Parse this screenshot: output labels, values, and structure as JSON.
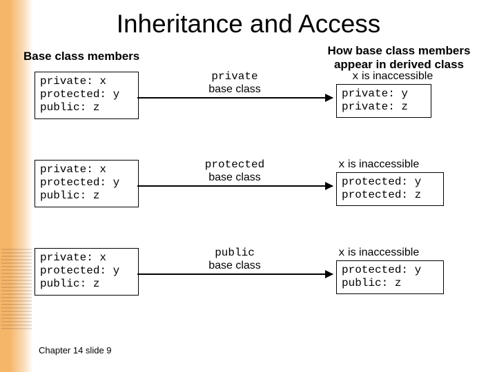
{
  "title": "Inheritance and Access",
  "subtitle_left": "Base class members",
  "subtitle_right": "How base class members appear in derived class",
  "base_members": "private: x\nprotected: y\npublic: z",
  "rows": [
    {
      "arrow_label_kw": "private",
      "arrow_label_rest": "base class",
      "inaccessible_var": "x",
      "inaccessible_text": " is inaccessible",
      "derived_members": "private: y\nprivate: z"
    },
    {
      "arrow_label_kw": "protected",
      "arrow_label_rest": "base class",
      "inaccessible_var": "x",
      "inaccessible_text": " is inaccessible",
      "derived_members": "protected: y\nprotected: z"
    },
    {
      "arrow_label_kw": "public",
      "arrow_label_rest": "base class",
      "inaccessible_var": "x",
      "inaccessible_text": " is inaccessible",
      "derived_members": "protected: y\npublic: z"
    }
  ],
  "footer": "Chapter 14 slide 9"
}
